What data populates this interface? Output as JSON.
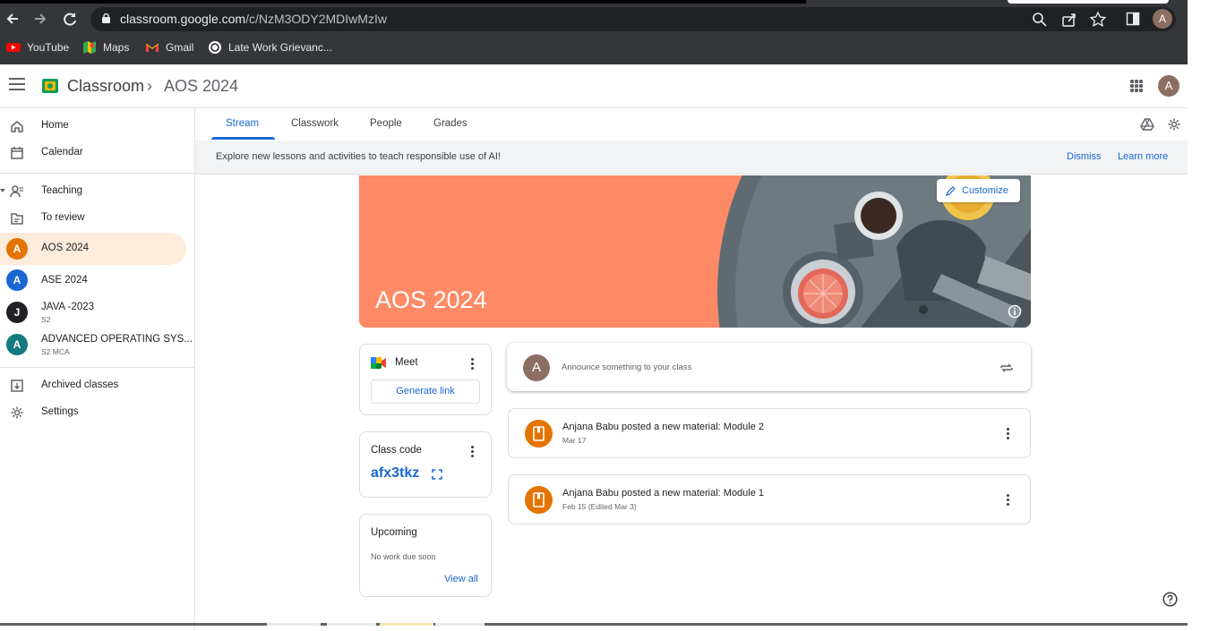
{
  "browser": {
    "url_domain": "classroom.google.com",
    "url_path": "/c/NzM3ODY2MDIwMzIw",
    "profile_initial": "A",
    "bookmarks": [
      "YouTube",
      "Maps",
      "Gmail",
      "Late Work Grievanc..."
    ]
  },
  "header": {
    "app_name": "Classroom",
    "separator": "›",
    "class_name": "AOS 2024",
    "avatar_initial": "A"
  },
  "sidebar": {
    "home": "Home",
    "calendar": "Calendar",
    "teaching": "Teaching",
    "to_review": "To review",
    "classes": [
      {
        "initial": "A",
        "name": "AOS 2024",
        "section": "",
        "color": "#e37400",
        "active": true
      },
      {
        "initial": "A",
        "name": "ASE 2024",
        "section": "",
        "color": "#1967d2",
        "active": false
      },
      {
        "initial": "J",
        "name": "JAVA -2023",
        "section": "S2",
        "color": "#202124",
        "active": false
      },
      {
        "initial": "A",
        "name": "ADVANCED OPERATING SYS...",
        "section": "S2 MCA",
        "color": "#137a7f",
        "active": false
      }
    ],
    "archived": "Archived classes",
    "settings": "Settings"
  },
  "tabs": {
    "stream": "Stream",
    "classwork": "Classwork",
    "people": "People",
    "grades": "Grades"
  },
  "banner": {
    "text": "Explore new lessons and activities to teach responsible use of AI!",
    "dismiss": "Dismiss",
    "learn_more": "Learn more"
  },
  "hero": {
    "title": "AOS 2024",
    "customize": "Customize",
    "color": "#ff8a65"
  },
  "meet": {
    "title": "Meet",
    "generate_link": "Generate link"
  },
  "class_code": {
    "title": "Class code",
    "code": "afx3tkz"
  },
  "upcoming": {
    "title": "Upcoming",
    "empty": "No work due soon",
    "view_all": "View all"
  },
  "announce": {
    "avatar_initial": "A",
    "placeholder": "Announce something to your class"
  },
  "posts": [
    {
      "title": "Anjana Babu posted a new material: Module 2",
      "date": "Mar 17"
    },
    {
      "title": "Anjana Babu posted a new material: Module 1",
      "date": "Feb 15 (Edited Mar 3)"
    }
  ]
}
